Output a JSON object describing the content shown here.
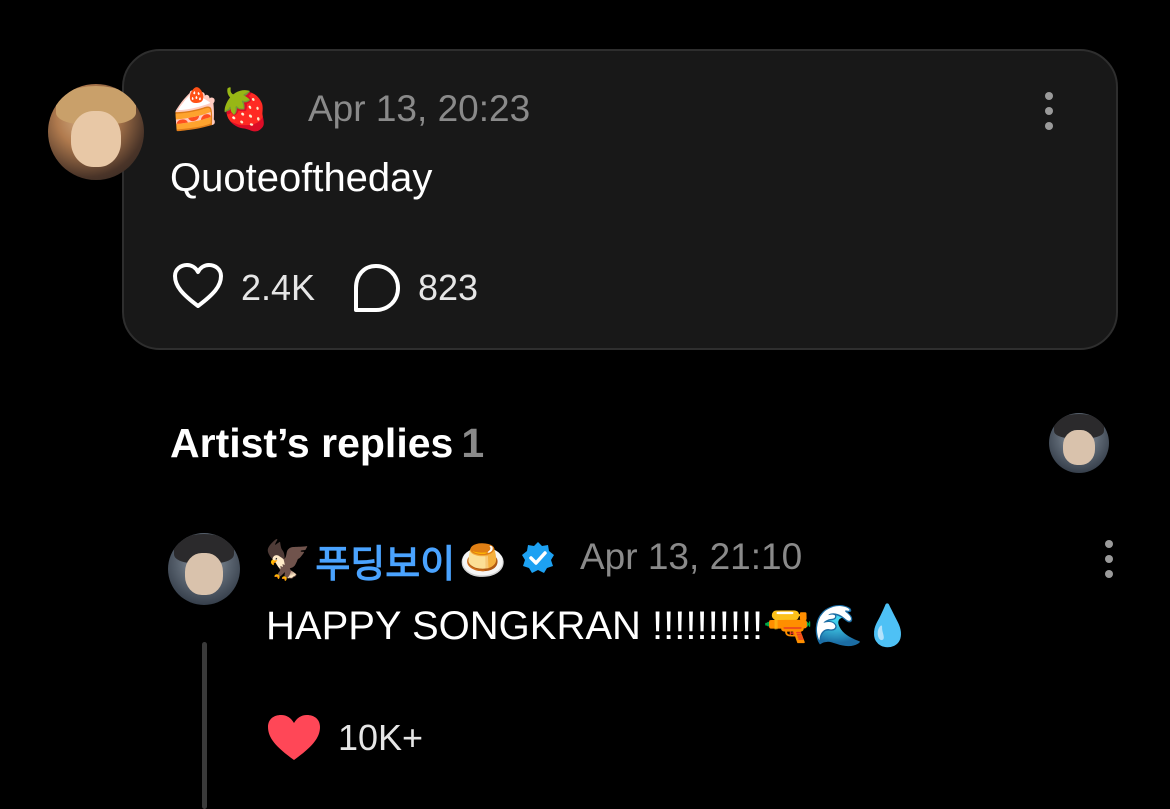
{
  "post": {
    "author_emojis": "🍰🍓",
    "timestamp": "Apr 13, 20:23",
    "text": "Quoteoftheday",
    "likes": "2.4K",
    "comments": "823"
  },
  "replies_section": {
    "title": "Artist’s replies",
    "count": "1"
  },
  "reply": {
    "name_prefix_emoji": "🦅",
    "name": "푸딩보이",
    "name_suffix_emoji": "🍮",
    "timestamp": "Apr 13, 21:10",
    "text": "HAPPY SONGKRAN !!!!!!!!!!🔫🌊💧",
    "likes": "10K+"
  },
  "colors": {
    "background": "#000000",
    "card": "#181818",
    "name_blue": "#4aa3ff",
    "verified": "#1da1f2",
    "like_red": "#ff4757"
  }
}
